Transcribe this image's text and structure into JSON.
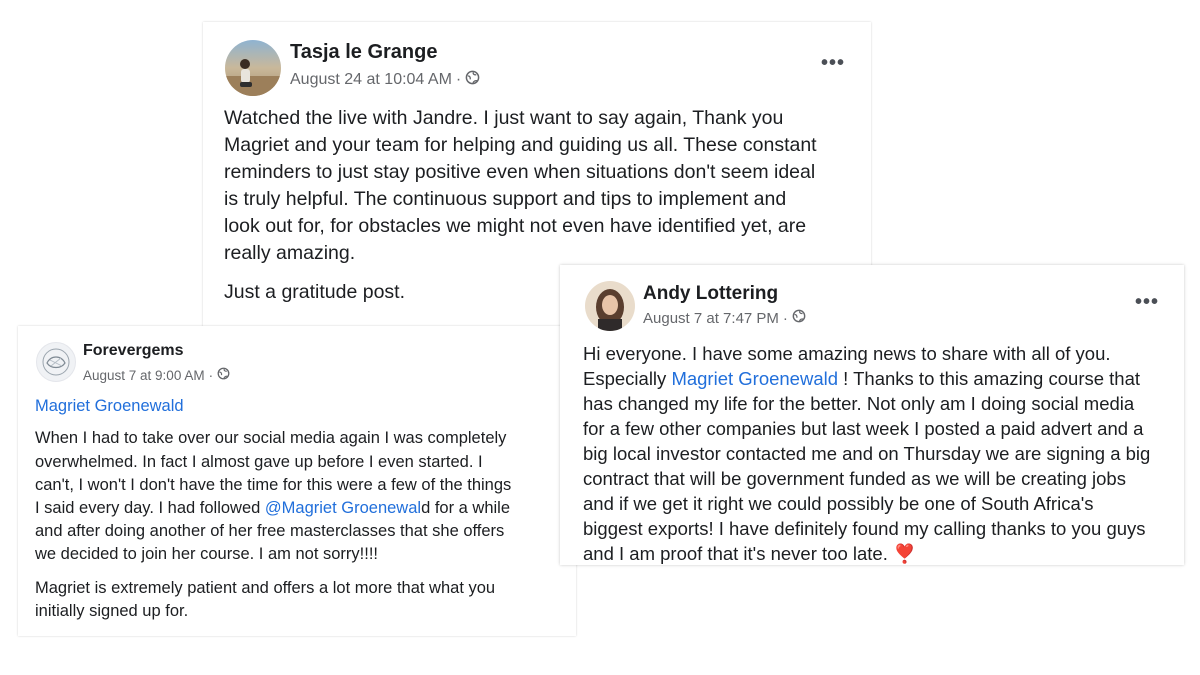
{
  "posts": [
    {
      "author": "Tasja le Grange",
      "timestamp": "August 24 at 10:04 AM",
      "separator": "·",
      "more": "•••",
      "lines": [
        "Watched the live with Jandre. I just want to say again, Thank you",
        "Magriet and your team for helping and guiding us all. These constant",
        "reminders to just stay positive even when situations don't seem ideal",
        "is truly helpful. The continuous support and tips to implement and",
        "look out for, for obstacles we might not even have identified yet, are",
        "really amazing.",
        "Just a gratitude post."
      ]
    },
    {
      "author": "Andy Lottering",
      "timestamp": "August 7 at 7:47 PM",
      "separator": "·",
      "more": "•••",
      "line1": "Hi everyone. I have some amazing news to share with all of you.",
      "line2_pre": "Especially ",
      "line2_mention": "Magriet Groenewald",
      "line2_post": " ! Thanks to this amazing course that",
      "lines": [
        "has changed my life for the better. Not only am I doing social media",
        "for a few other companies but last week I posted a paid advert and a",
        "big local investor contacted me and on Thursday we are signing a big",
        "contract that will be government funded as we will be creating jobs",
        "and if we get it right we could possibly be one of South Africa's",
        "biggest exports! I have definitely found my calling thanks to you guys"
      ],
      "last_line": "and I am proof that it's never too late.",
      "emoji": "❣️"
    },
    {
      "author": "Forevergems",
      "timestamp": "August 7 at 9:00 AM",
      "separator": "·",
      "mention": "Magriet Groenewald",
      "lines_a": [
        "When I had to take over our social media again I was completely",
        "overwhelmed.  In fact I almost gave up before I even started.  I",
        "can't, I won't I don't have the time for this were a few of the things"
      ],
      "line4_pre": "I said every day.  I had followed ",
      "line4_mention": "@Magriet Groenewal",
      "line4_post": "d for a while",
      "lines_b": [
        "and after doing another of her free masterclasses that she offers",
        "we decided to join her course.  I am not sorry!!!!"
      ],
      "lines_c": [
        "Magriet is extremely patient and offers a lot more that what you",
        "initially signed up for."
      ]
    }
  ]
}
